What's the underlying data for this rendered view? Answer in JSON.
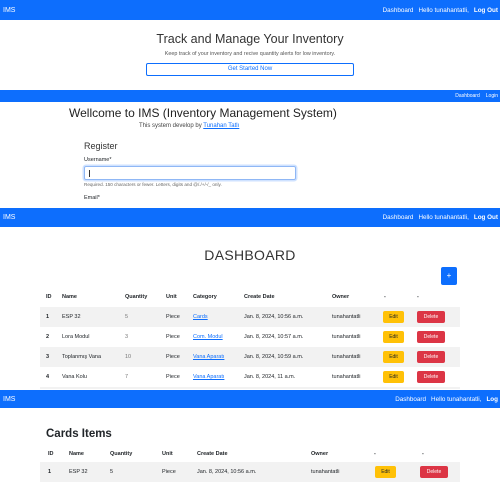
{
  "screen1": {
    "nav": {
      "brand": "IMS",
      "links": [
        "Dashboard",
        "Hello tunahantatli,"
      ],
      "logout": "Log Out"
    },
    "heading": "Track and Manage Your Inventory",
    "subtext": "Keep track of your inventory and recive quantity alerts for low inventory.",
    "cta": "Get Started Now"
  },
  "screen2": {
    "nav": {
      "links": [
        "Dashboard",
        "Login"
      ]
    },
    "heading": "Wellcome to IMS (Inventory Management System)",
    "by_text": "This system develop by",
    "by_link": "Tunahan Tatlı",
    "register_title": "Register",
    "username_label": "Username*",
    "username_help": "Required. 150 characters or fewer. Letters, digits and @/./+/-/_ only.",
    "email_label": "Email*"
  },
  "screen3": {
    "nav": {
      "brand": "IMS",
      "links": [
        "Dashboard",
        "Hello tunahantatli,"
      ],
      "logout": "Log Out"
    },
    "title": "DASHBOARD",
    "add_button": "+",
    "headers": [
      "ID",
      "Name",
      "Quantity",
      "Unit",
      "Category",
      "Create Date",
      "Owner",
      "-",
      "-"
    ],
    "rows": [
      {
        "id": "1",
        "name": "ESP 32",
        "quantity": "5",
        "unit": "Piece",
        "category": "Cards",
        "date": "Jan. 8, 2024, 10:56 a.m.",
        "owner": "tunahantatli"
      },
      {
        "id": "2",
        "name": "Lora Modul",
        "quantity": "3",
        "unit": "Piece",
        "category": "Com. Modul",
        "date": "Jan. 8, 2024, 10:57 a.m.",
        "owner": "tunahantatli"
      },
      {
        "id": "3",
        "name": "Toplanmış Vana",
        "quantity": "10",
        "unit": "Piece",
        "category": "Vana Aparatı",
        "date": "Jan. 8, 2024, 10:59 a.m.",
        "owner": "tunahantatli"
      },
      {
        "id": "4",
        "name": "Vana Kolu",
        "quantity": "7",
        "unit": "Piece",
        "category": "Vana Aparatı",
        "date": "Jan. 8, 2024, 11 a.m.",
        "owner": "tunahantatli"
      }
    ],
    "edit_label": "Edit",
    "delete_label": "Delete"
  },
  "screen4": {
    "nav": {
      "brand": "IMS",
      "links": [
        "Dashboard",
        "Hello tunahantatli,"
      ],
      "logout": "Log"
    },
    "title": "Cards Items",
    "headers": [
      "ID",
      "Name",
      "Quantity",
      "Unit",
      "Create Date",
      "Owner",
      "-",
      "-"
    ],
    "rows": [
      {
        "id": "1",
        "name": "ESP 32",
        "quantity": "5",
        "unit": "Piece",
        "date": "Jan. 8, 2024, 10:56 a.m.",
        "owner": "tunahantatli"
      }
    ],
    "edit_label": "Edit",
    "delete_label": "Delete"
  },
  "colors": {
    "primary": "#0d6efd",
    "warning": "#ffc107",
    "danger": "#dc3545"
  }
}
